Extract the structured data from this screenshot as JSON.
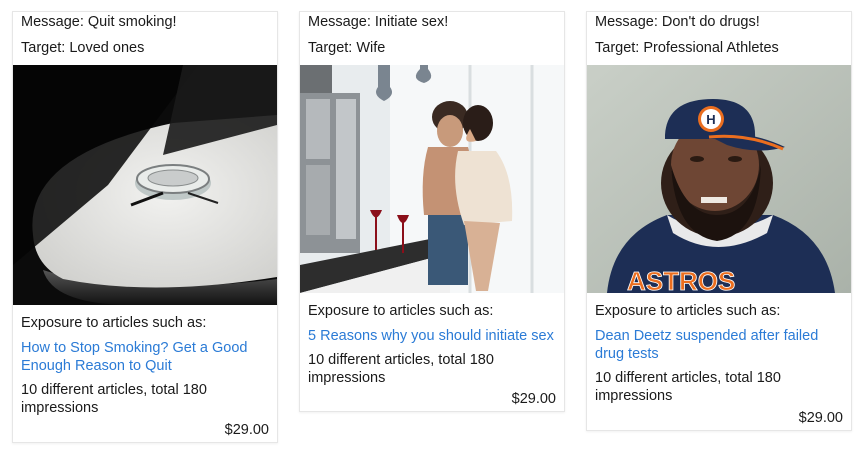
{
  "cards": [
    {
      "message": "Message: Quit smoking!",
      "target": "Target: Loved ones",
      "image_subject": "ashtray on a round table in sunlight",
      "exposure_label": "Exposure to articles such as:",
      "article_link": "How to Stop Smoking? Get a Good Enough Reason to Quit",
      "stats": "10 different articles, total 180 impressions",
      "price": "$29.00"
    },
    {
      "message": "Message: Initiate sex!",
      "target": "Target: Wife",
      "image_subject": "couple embracing in a kitchen",
      "exposure_label": "Exposure to articles such as:",
      "article_link": "5 Reasons why you should initiate sex",
      "stats": "10 different articles, total 180 impressions",
      "price": "$29.00"
    },
    {
      "message": "Message: Don't do drugs!",
      "target": "Target: Professional Athletes",
      "image_subject": "bearded man in Astros cap and jersey",
      "exposure_label": "Exposure to articles such as:",
      "article_link": "Dean Deetz suspended after failed drug tests",
      "stats": "10 different articles, total 180 impressions",
      "price": "$29.00"
    }
  ],
  "logo_text": "ASTROS",
  "cap_logo": "H",
  "colors": {
    "link": "#2b7bd6",
    "astros_navy": "#1d2e55",
    "astros_orange": "#eb6e1f"
  }
}
